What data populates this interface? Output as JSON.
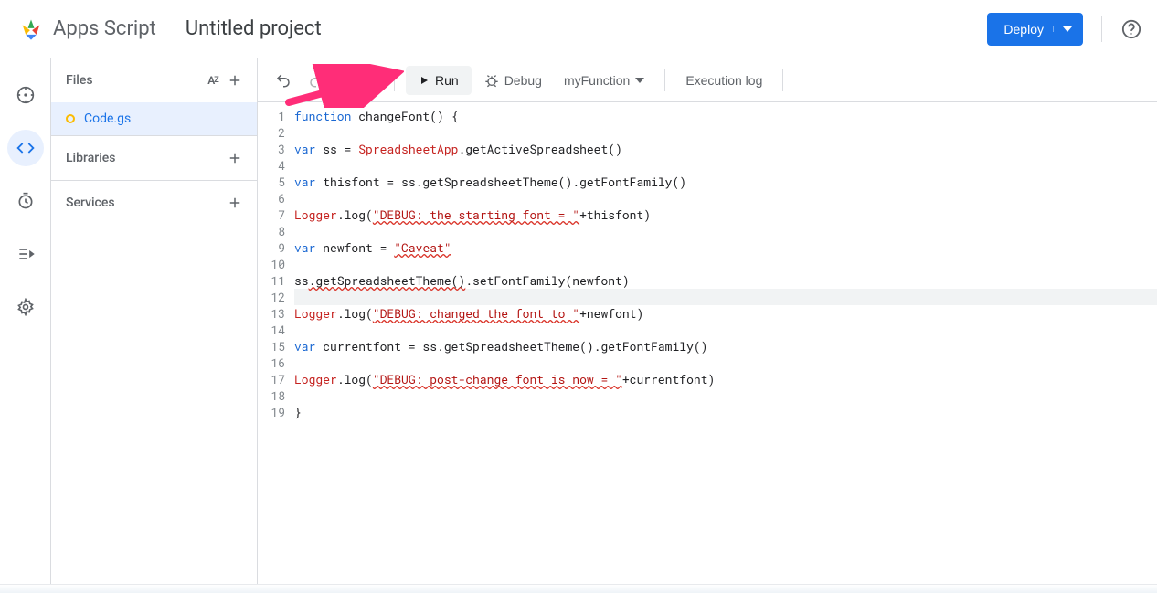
{
  "header": {
    "app_name": "Apps Script",
    "project_title": "Untitled project",
    "deploy_label": "Deploy"
  },
  "rail": {
    "items": [
      "overview",
      "editor",
      "triggers",
      "executions",
      "settings"
    ],
    "active": "editor"
  },
  "files_panel": {
    "files_label": "Files",
    "libraries_label": "Libraries",
    "services_label": "Services",
    "file_name": "Code.gs"
  },
  "toolbar": {
    "run_label": "Run",
    "debug_label": "Debug",
    "function_selector": "myFunction",
    "execution_log_label": "Execution log"
  },
  "code": {
    "highlight_line": 12,
    "lines": [
      {
        "n": 1,
        "tokens": [
          [
            "kw",
            "function "
          ],
          [
            "fn",
            "changeFont"
          ],
          [
            "plain",
            "() "
          ],
          [
            "plain",
            "{"
          ]
        ]
      },
      {
        "n": 2,
        "tokens": []
      },
      {
        "n": 3,
        "tokens": [
          [
            "kw",
            "var "
          ],
          [
            "plain",
            "ss = "
          ],
          [
            "cls",
            "SpreadsheetApp"
          ],
          [
            "plain",
            ".getActiveSpreadsheet()"
          ]
        ]
      },
      {
        "n": 4,
        "tokens": []
      },
      {
        "n": 5,
        "tokens": [
          [
            "kw",
            "var "
          ],
          [
            "plain",
            "thisfont = ss.getSpreadsheetTheme().getFontFamily()"
          ]
        ]
      },
      {
        "n": 6,
        "tokens": []
      },
      {
        "n": 7,
        "tokens": [
          [
            "cls",
            "Logger"
          ],
          [
            "plain",
            ".log("
          ],
          [
            "str",
            "\"DEBUG: the starting font = \""
          ],
          [
            "plain",
            "+thisfont)"
          ]
        ],
        "squiggles": [
          2
        ]
      },
      {
        "n": 8,
        "tokens": []
      },
      {
        "n": 9,
        "tokens": [
          [
            "kw",
            "var "
          ],
          [
            "plain",
            "newfont = "
          ],
          [
            "str",
            "\"Caveat\""
          ]
        ],
        "squiggles": [
          2
        ]
      },
      {
        "n": 10,
        "tokens": []
      },
      {
        "n": 11,
        "tokens": [
          [
            "plain",
            "ss"
          ],
          [
            "sq",
            ".getSpreadsheetTheme()"
          ],
          [
            "plain",
            ".setFontFamily(newfont)"
          ]
        ]
      },
      {
        "n": 12,
        "tokens": []
      },
      {
        "n": 13,
        "tokens": [
          [
            "cls",
            "Logger"
          ],
          [
            "plain",
            ".log("
          ],
          [
            "str",
            "\"DEBUG: changed the font to \""
          ],
          [
            "plain",
            "+newfont)"
          ]
        ],
        "squiggles": [
          2
        ]
      },
      {
        "n": 14,
        "tokens": []
      },
      {
        "n": 15,
        "tokens": [
          [
            "kw",
            "var "
          ],
          [
            "plain",
            "currentfont = ss.getSpreadsheetTheme().getFontFamily()"
          ]
        ]
      },
      {
        "n": 16,
        "tokens": []
      },
      {
        "n": 17,
        "tokens": [
          [
            "cls",
            "Logger"
          ],
          [
            "plain",
            ".log("
          ],
          [
            "str",
            "\"DEBUG: post-change font is now = \""
          ],
          [
            "plain",
            "+currentfont)"
          ]
        ],
        "squiggles": [
          2
        ]
      },
      {
        "n": 18,
        "tokens": []
      },
      {
        "n": 19,
        "tokens": [
          [
            "plain",
            "}"
          ]
        ]
      }
    ]
  }
}
